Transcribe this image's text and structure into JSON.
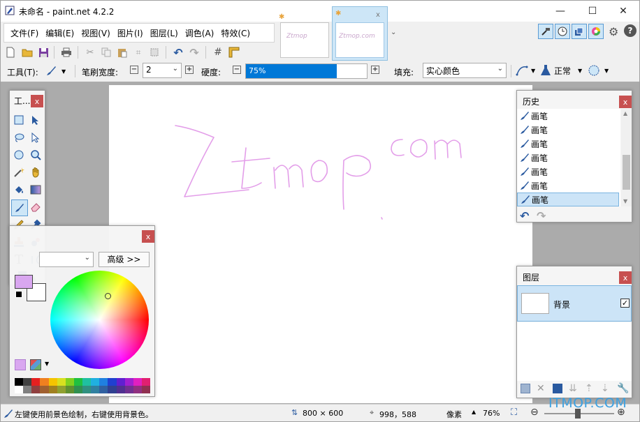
{
  "window": {
    "title": "未命名 - paint.net 4.2.2",
    "controls": {
      "minimize": "—",
      "maximize": "☐",
      "close": "✕"
    }
  },
  "menu": [
    "文件(F)",
    "编辑(E)",
    "视图(V)",
    "图片(I)",
    "图层(L)",
    "调色(A)",
    "特效(C)"
  ],
  "image_tabs": [
    {
      "caption": "Ztmop",
      "active": false
    },
    {
      "caption": "Ztmop.com",
      "active": true
    }
  ],
  "toolbar": {
    "tool_label": "工具(T):",
    "brush_width_label": "笔刷宽度:",
    "brush_width_value": "2",
    "hardness_label": "硬度:",
    "hardness_value": "75%",
    "hardness_fraction": 0.75,
    "fill_label": "填充:",
    "fill_value": "实心颜色",
    "blend_value": "正常"
  },
  "tools_panel": {
    "title": "工..."
  },
  "canvas": {
    "drawing_text": "Ztmop.com",
    "stroke_color": "#e39ee9"
  },
  "colors_panel": {
    "advanced_button": "高级 >>"
  },
  "history_panel": {
    "title": "历史",
    "items": [
      "画笔",
      "画笔",
      "画笔",
      "画笔",
      "画笔",
      "画笔",
      "画笔"
    ],
    "selected_index": 6
  },
  "layers_panel": {
    "title": "图层",
    "layer_name": "背景",
    "visible": true
  },
  "status": {
    "hint": "左键使用前景色绘制，右键使用背景色。",
    "image_size": "800 × 600",
    "cursor_pos": "998，588",
    "units": "像素",
    "zoom": "76%"
  },
  "watermark": "ITMOP.COM",
  "colors": {
    "accent": "#0078d7",
    "selection": "#cce4f7",
    "close": "#c75050"
  }
}
